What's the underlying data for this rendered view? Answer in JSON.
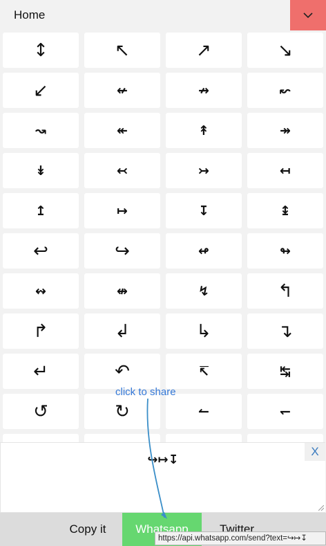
{
  "header": {
    "title": "Home",
    "menu_icon": "chevron-down-icon",
    "menu_color": "#ef6f6c"
  },
  "arrows": {
    "rows": [
      [
        "↕",
        "↖",
        "↗",
        "↘"
      ],
      [
        "↙",
        "↚",
        "↛",
        "↜"
      ],
      [
        "↝",
        "↞",
        "↟",
        "↠"
      ],
      [
        "↡",
        "↢",
        "↣",
        "↤"
      ],
      [
        "↥",
        "↦",
        "↧",
        "↨"
      ],
      [
        "↩",
        "↪",
        "↫",
        "↬"
      ],
      [
        "↭",
        "↮",
        "↯",
        "↰"
      ],
      [
        "↱",
        "↲",
        "↳",
        "↴"
      ],
      [
        "↵",
        "↶",
        "↸",
        "↹"
      ],
      [
        "↺",
        "↻",
        "↼",
        "↽"
      ]
    ]
  },
  "share": {
    "text": "↪↦↧",
    "close_label": "X",
    "hint": "click to share",
    "copy_label": "Copy it",
    "whatsapp_label": "Whatsapp",
    "twitter_label": "Twitter",
    "whatsapp_color": "#66d770",
    "url_tooltip": "https://api.whatsapp.com/send?text=↪↦↧"
  }
}
